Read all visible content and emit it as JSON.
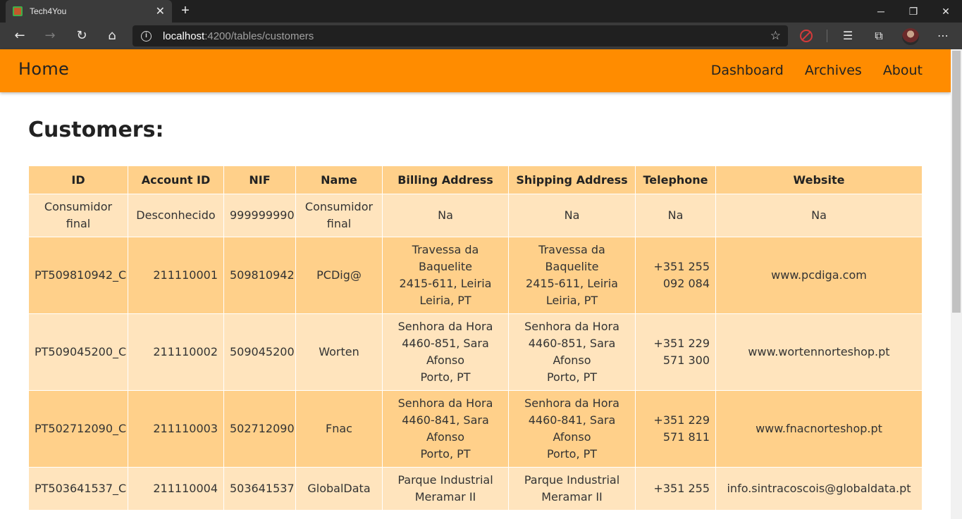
{
  "browser": {
    "tab_title": "Tech4You",
    "url_host": "localhost",
    "url_path": ":4200/tables/customers",
    "icons": [
      "back-icon",
      "forward-icon",
      "refresh-icon",
      "home-icon",
      "star-icon",
      "favorites-icon",
      "collections-icon",
      "more-icon"
    ]
  },
  "navbar": {
    "brand": "Home",
    "links": [
      "Dashboard",
      "Archives",
      "About"
    ]
  },
  "page": {
    "title": "Customers:"
  },
  "table": {
    "headers": [
      "ID",
      "Account ID",
      "NIF",
      "Name",
      "Billing Address",
      "Shipping Address",
      "Telephone",
      "Website"
    ],
    "rows": [
      {
        "id": "Consumidor final",
        "account_id": "Desconhecido",
        "nif": "999999990",
        "name": "Consumidor final",
        "billing": [
          "Na"
        ],
        "shipping": [
          "Na"
        ],
        "telephone": "Na",
        "website": "Na"
      },
      {
        "id": "PT509810942_C",
        "account_id": "211110001",
        "nif": "509810942",
        "name": "PCDig@",
        "billing": [
          "Travessa da",
          "Baquelite",
          "2415-611, Leiria",
          "Leiria, PT"
        ],
        "shipping": [
          "Travessa da",
          "Baquelite",
          "2415-611, Leiria",
          "Leiria, PT"
        ],
        "telephone": "+351 255 092 084",
        "website": "www.pcdiga.com"
      },
      {
        "id": "PT509045200_C",
        "account_id": "211110002",
        "nif": "509045200",
        "name": "Worten",
        "billing": [
          "Senhora da Hora",
          "4460-851, Sara",
          "Afonso",
          "Porto, PT"
        ],
        "shipping": [
          "Senhora da Hora",
          "4460-851, Sara",
          "Afonso",
          "Porto, PT"
        ],
        "telephone": "+351 229 571 300",
        "website": "www.wortennorteshop.pt"
      },
      {
        "id": "PT502712090_C",
        "account_id": "211110003",
        "nif": "502712090",
        "name": "Fnac",
        "billing": [
          "Senhora da Hora",
          "4460-841, Sara",
          "Afonso",
          "Porto, PT"
        ],
        "shipping": [
          "Senhora da Hora",
          "4460-841, Sara",
          "Afonso",
          "Porto, PT"
        ],
        "telephone": "+351 229 571 811",
        "website": "www.fnacnorteshop.pt"
      },
      {
        "id": "PT503641537_C",
        "account_id": "211110004",
        "nif": "503641537",
        "name": "GlobalData",
        "billing": [
          "Parque Industrial",
          "Meramar II"
        ],
        "shipping": [
          "Parque Industrial",
          "Meramar II"
        ],
        "telephone": "+351 255",
        "website": "info.sintracoscois@globaldata.pt"
      }
    ]
  }
}
